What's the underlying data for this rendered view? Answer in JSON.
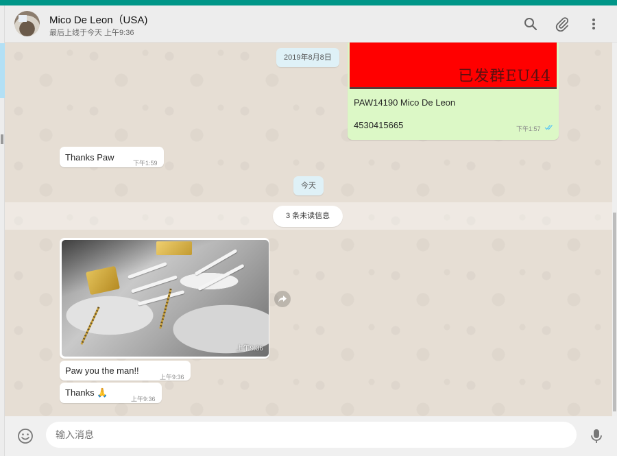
{
  "header": {
    "contact_name": "Mico De Leon（USA)",
    "last_seen": "最后上线于今天 上午9:36"
  },
  "chat": {
    "date_chips": [
      "2019年8月8日",
      "今天"
    ],
    "unread_label": "3 条未读信息",
    "outgoing_image_message": {
      "image_caption": "已发群EU44",
      "text_line_1": "PAW14190  Mico De Leon",
      "text_line_2": "4530415665",
      "time": "下午1:57",
      "status": "read"
    },
    "messages": [
      {
        "text": "Thanks Paw",
        "time": "下午1:59"
      },
      {
        "text": "Paw you the man!!",
        "time": "上午9:36"
      },
      {
        "text": "Thanks 🙏",
        "time": "上午9:36"
      }
    ],
    "photo_message": {
      "time": "上午9:36"
    }
  },
  "composer": {
    "placeholder": "输入消息"
  },
  "icons": [
    "search-icon",
    "attach-icon",
    "menu-icon",
    "forward-icon",
    "emoji-icon",
    "mic-icon"
  ],
  "colors": {
    "accent": "#009688",
    "outgoing_bubble": "#dcf8c6",
    "incoming_bubble": "#ffffff",
    "read_ticks": "#4fc3f7"
  }
}
